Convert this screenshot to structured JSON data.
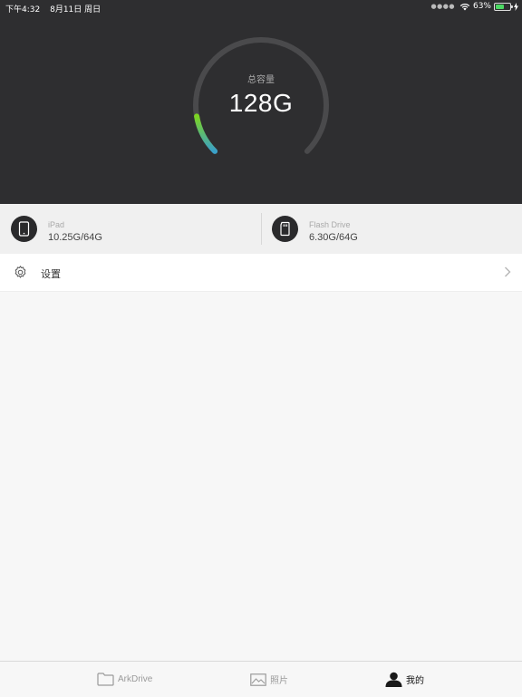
{
  "status_bar": {
    "time": "下午4:32",
    "date": "8月11日 周日",
    "battery_percent": "63%",
    "battery_level": 0.63
  },
  "capacity": {
    "label": "总容量",
    "value": "128G",
    "used_fraction": 0.13
  },
  "devices": [
    {
      "name": "iPad",
      "usage": "10.25G/64G",
      "icon": "ipad-icon"
    },
    {
      "name": "Flash Drive",
      "usage": "6.30G/64G",
      "icon": "sd-card-icon"
    }
  ],
  "settings": {
    "label": "设置"
  },
  "tabs": [
    {
      "label": "ArkDrive",
      "icon": "folder-icon",
      "active": false
    },
    {
      "label": "照片",
      "icon": "image-icon",
      "active": false
    },
    {
      "label": "我的",
      "icon": "user-icon",
      "active": true
    }
  ],
  "colors": {
    "header_bg": "#2e2e30",
    "gauge_track": "#4a4a4c",
    "gauge_start": "#3aa0c8",
    "gauge_end": "#7cd322",
    "active_tab": "#111111",
    "inactive_tab": "#9a9a9a"
  }
}
